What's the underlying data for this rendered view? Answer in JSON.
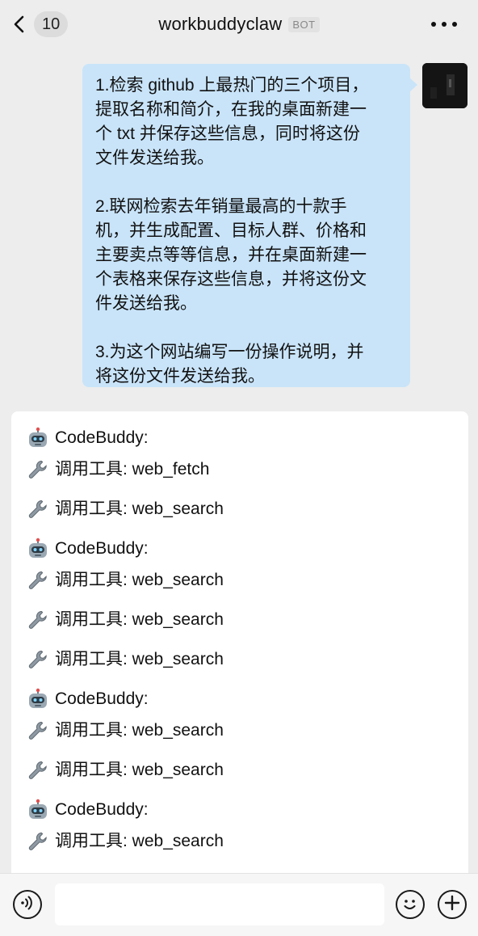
{
  "header": {
    "unread_count": "10",
    "title": "workbuddyclaw",
    "bot_tag": "BOT",
    "icons": {
      "back": "chevron-left-icon",
      "more": "more-dots-icon"
    }
  },
  "user_message": {
    "lines": [
      "1.检索 github 上最热门的三个项目，",
      "提取名称和简介，在我的桌面新建一",
      "个 txt 并保存这些信息，同时将这份",
      "文件发送给我。",
      "",
      "2.联网检索去年销量最高的十款手",
      "机，并生成配置、目标人群、价格和",
      "主要卖点等等信息，并在桌面新建一",
      "个表格来保存这些信息，并将这份文",
      "件发送给我。",
      "",
      "3.为这个网站编写一份操作说明，并",
      "将这份文件发送给我。"
    ],
    "bubble_color": "#c9e4f9"
  },
  "bot_message": {
    "items": [
      {
        "icon": "robot-icon",
        "text": "CodeBuddy:"
      },
      {
        "icon": "wrench-icon",
        "text": "调用工具: web_fetch"
      },
      {
        "icon": "wrench-icon",
        "text": "调用工具: web_search"
      },
      {
        "icon": "robot-icon",
        "text": "CodeBuddy:"
      },
      {
        "icon": "wrench-icon",
        "text": "调用工具: web_search"
      },
      {
        "icon": "wrench-icon",
        "text": "调用工具: web_search"
      },
      {
        "icon": "wrench-icon",
        "text": "调用工具: web_search"
      },
      {
        "icon": "robot-icon",
        "text": "CodeBuddy:"
      },
      {
        "icon": "wrench-icon",
        "text": "调用工具: web_search"
      },
      {
        "icon": "wrench-icon",
        "text": "调用工具: web_search"
      },
      {
        "icon": "robot-icon",
        "text": "CodeBuddy:"
      },
      {
        "icon": "wrench-icon",
        "text": "调用工具: web_search"
      }
    ]
  },
  "input_bar": {
    "placeholder": "",
    "value": "",
    "icons": {
      "voice": "voice-icon",
      "emoji": "emoji-icon",
      "plus": "plus-icon"
    }
  },
  "colors": {
    "background": "#ededed",
    "bot_card": "#ffffff",
    "user_bubble": "#c9e4f9"
  }
}
